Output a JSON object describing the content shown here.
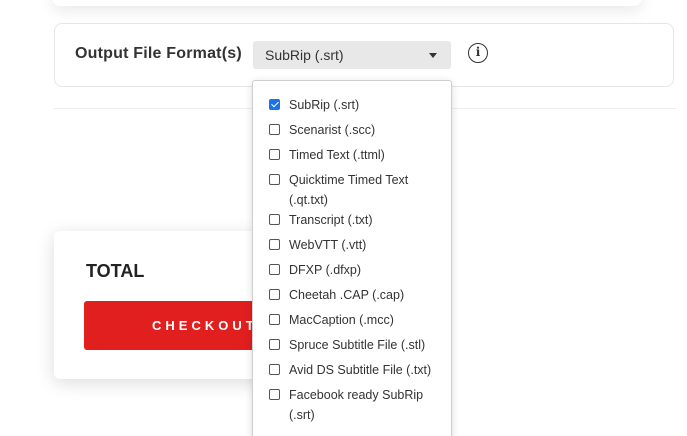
{
  "format": {
    "label": "Output File Format(s)",
    "selected": "SubRip (.srt)"
  },
  "info_icon_glyph": "i",
  "total": {
    "label": "TOTAL",
    "checkout_label": "CHECKOUT"
  },
  "dropdown": {
    "options": [
      {
        "label": "SubRip (.srt)",
        "checked": true
      },
      {
        "label": "Scenarist (.scc)",
        "checked": false
      },
      {
        "label": "Timed Text (.ttml)",
        "checked": false
      },
      {
        "label": "Quicktime Timed Text (.qt.txt)",
        "checked": false
      },
      {
        "label": "Transcript (.txt)",
        "checked": false
      },
      {
        "label": "WebVTT (.vtt)",
        "checked": false
      },
      {
        "label": "DFXP (.dfxp)",
        "checked": false
      },
      {
        "label": "Cheetah .CAP (.cap)",
        "checked": false
      },
      {
        "label": "MacCaption (.mcc)",
        "checked": false
      },
      {
        "label": "Spruce Subtitle File (.stl)",
        "checked": false
      },
      {
        "label": "Avid DS Subtitle File (.txt)",
        "checked": false
      },
      {
        "label": "Facebook ready SubRip (.srt)",
        "checked": false
      }
    ]
  },
  "colors": {
    "checkout_red": "#e11f1f",
    "checkbox_blue": "#1a73e8"
  }
}
